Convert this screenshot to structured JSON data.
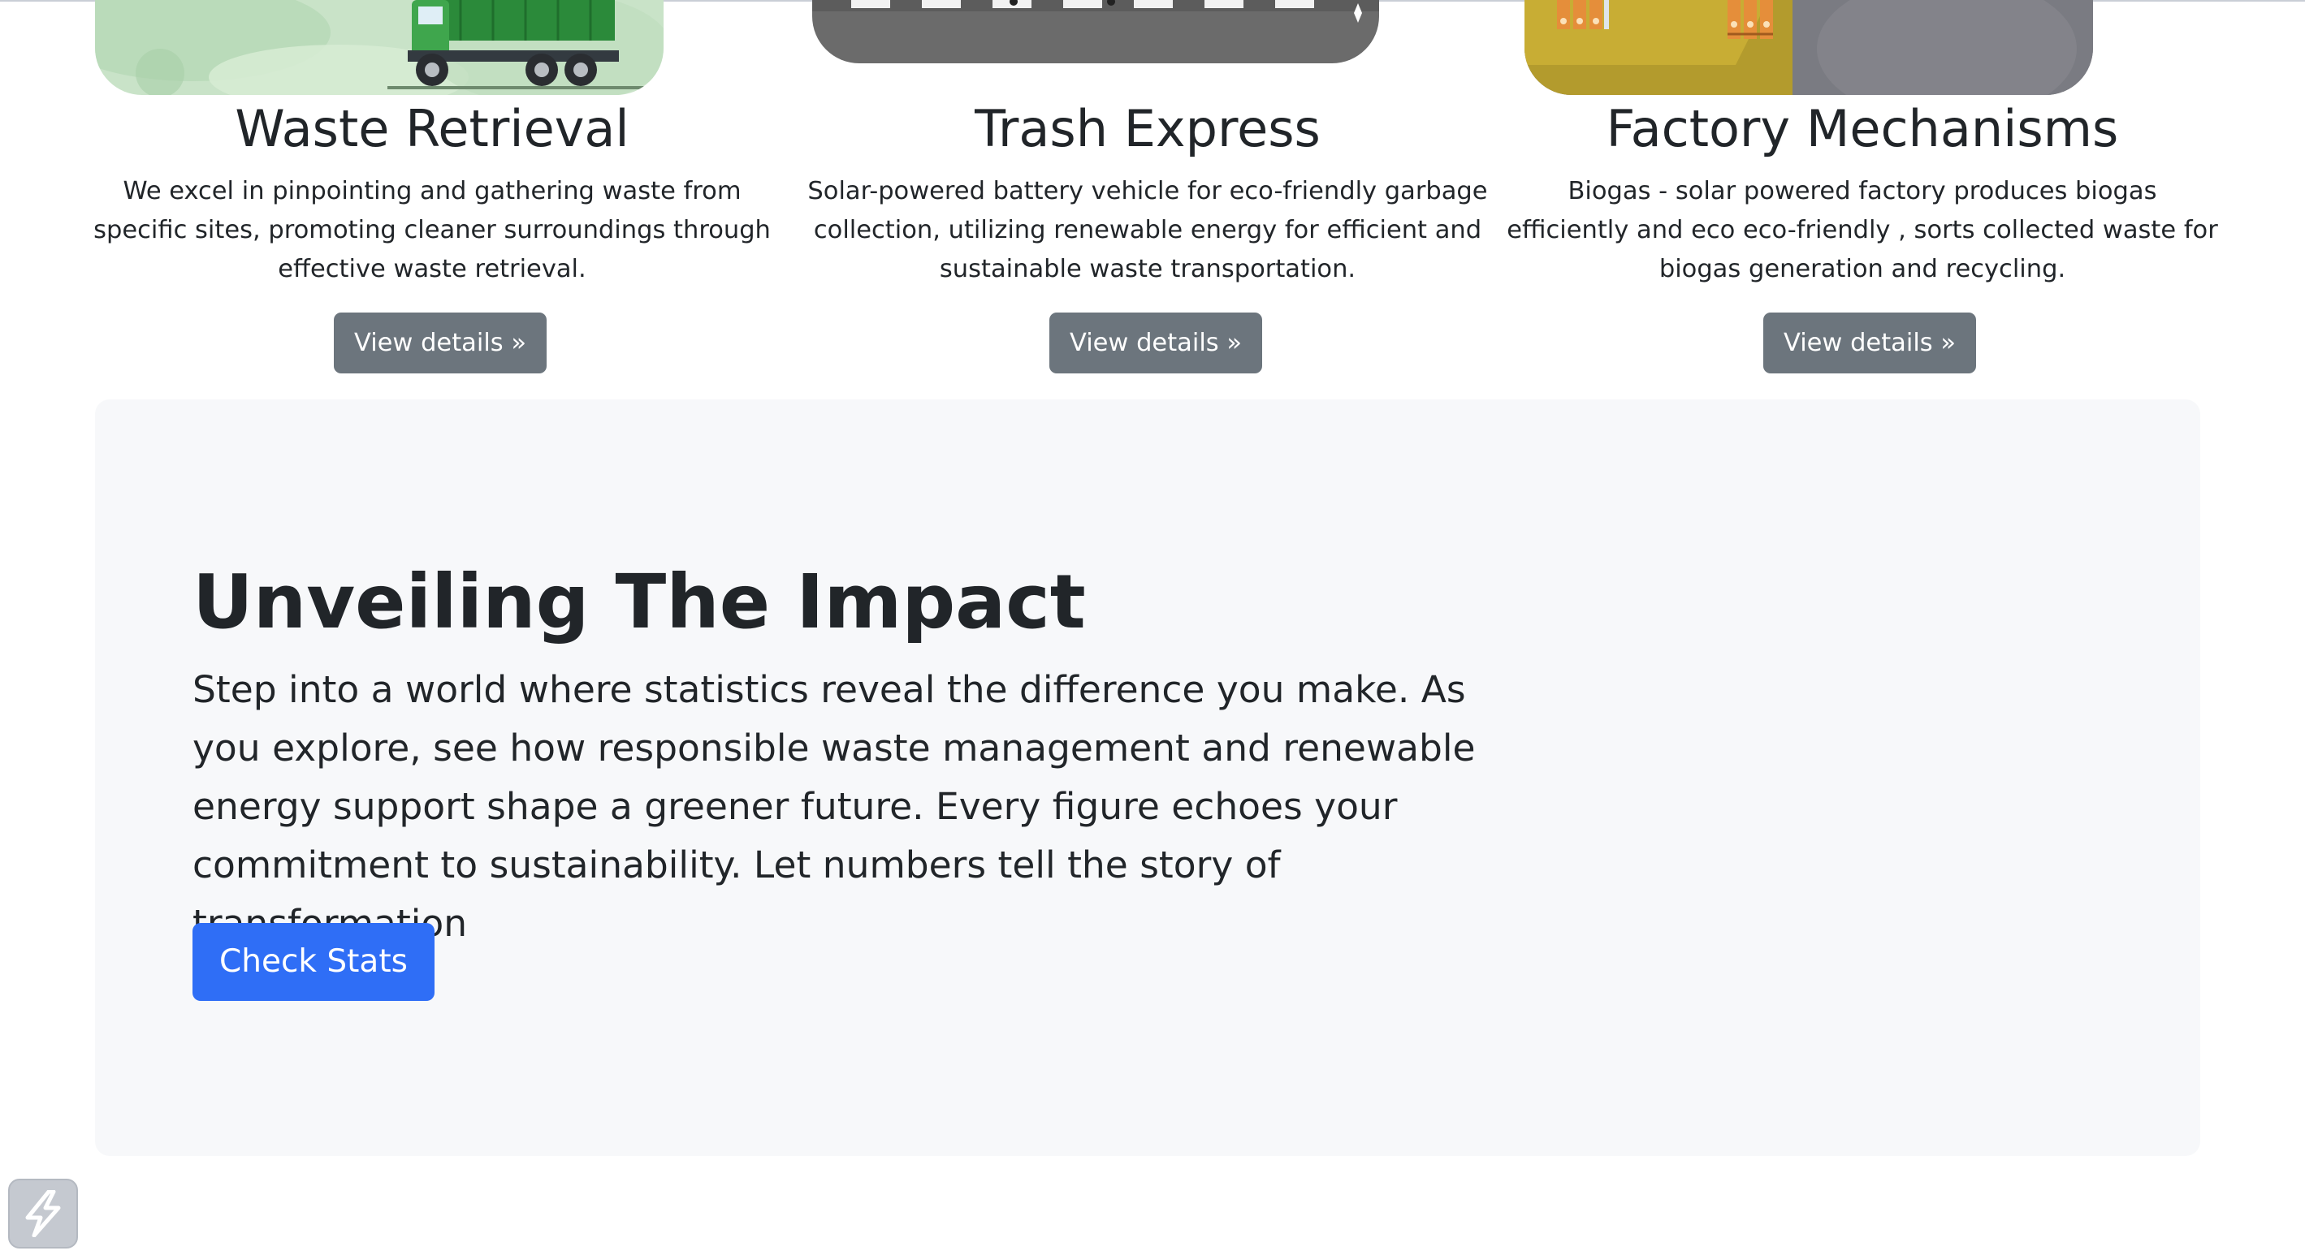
{
  "cards": [
    {
      "title": "Waste Retrieval",
      "description": "We excel in pinpointing and gathering waste from specific sites, promoting cleaner surroundings through effective waste retrieval.",
      "button": "View details »"
    },
    {
      "title": "Trash Express",
      "description": "Solar-powered battery vehicle for eco-friendly garbage collection, utilizing renewable energy for efficient and sustainable waste transportation.",
      "button": "View details »"
    },
    {
      "title": "Factory Mechanisms",
      "description": "Biogas - solar powered factory produces biogas efficiently and eco eco-friendly , sorts collected waste for biogas generation and recycling.",
      "button": "View details »"
    }
  ],
  "impact": {
    "title": "Unveiling The Impact",
    "text": "Step into a world where statistics reveal the difference you make. As you explore, see how responsible waste management and renewable energy support shape a greener future. Every figure echoes your commitment to sustainability. Let numbers tell the story of transformation",
    "button": "Check Stats"
  },
  "icons": {
    "floating_button": "lightning-bolt-icon"
  },
  "colors": {
    "secondary_button": "#6c757d",
    "primary_button": "#2f6ef6",
    "jumbotron_bg": "#f7f8fa",
    "text": "#212529"
  }
}
